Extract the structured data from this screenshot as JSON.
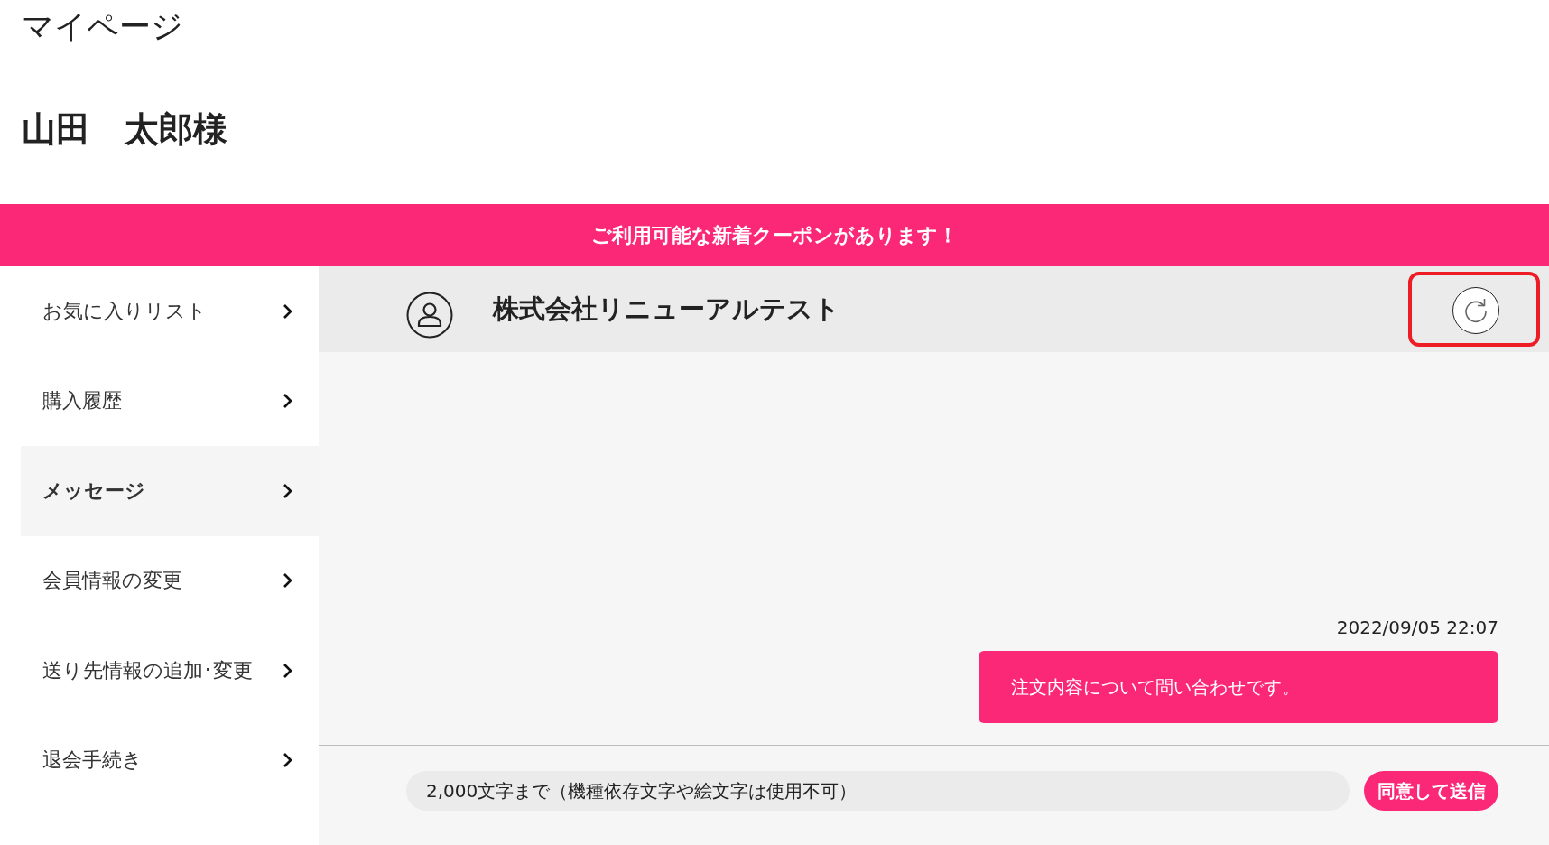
{
  "page_title": "マイページ",
  "user_name": "山田　太郎様",
  "coupon_banner": "ご利用可能な新着クーポンがあります！",
  "sidebar": {
    "items": [
      {
        "label": "お気に入りリスト",
        "selected": false
      },
      {
        "label": "購入履歴",
        "selected": false
      },
      {
        "label": "メッセージ",
        "selected": true
      },
      {
        "label": "会員情報の変更",
        "selected": false
      },
      {
        "label": "送り先情報の追加･変更",
        "selected": false
      },
      {
        "label": "退会手続き",
        "selected": false
      }
    ]
  },
  "chat": {
    "shop_name": "株式会社リニューアルテスト",
    "refresh_highlighted": true,
    "messages": [
      {
        "time": "2022/09/05 22:07",
        "text": "注文内容について問い合わせです。"
      }
    ],
    "input": {
      "placeholder": "2,000文字まで（機種依存文字や絵文字は使用不可）"
    },
    "send_button": "同意して送信"
  }
}
